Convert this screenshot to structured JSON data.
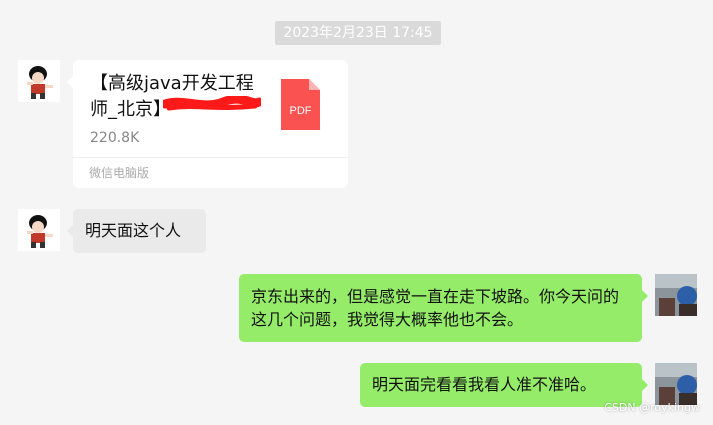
{
  "timestamp": "2023年2月23日 17:45",
  "file_message": {
    "file_name": "【高级java开发工程师_北京】",
    "file_size": "220.8K",
    "file_type": "PDF",
    "source": "微信电脑版"
  },
  "messages": [
    {
      "side": "left",
      "text": "明天面这个人"
    },
    {
      "side": "right",
      "text": "京东出来的，但是感觉一直在走下坡路。你今天问的这几个问题，我觉得大概率他也不会。"
    },
    {
      "side": "right",
      "text": "明天面完看看我看人准不准哈。"
    }
  ],
  "watermark": "CSDN @roykingw",
  "colors": {
    "background": "#f5f5f5",
    "bubble_self": "#95ec69",
    "bubble_other": "#eaeaea",
    "pdf_icon": "#fa5151",
    "redaction": "#ff1a1a"
  }
}
